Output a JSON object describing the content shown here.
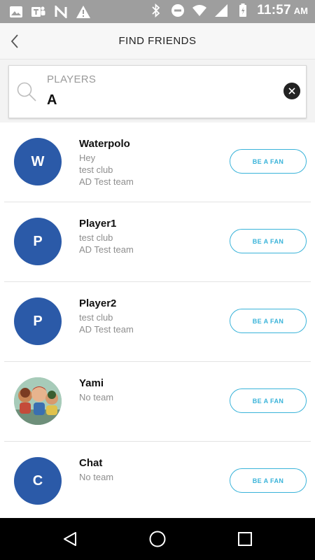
{
  "status_bar": {
    "time": "11:57",
    "ampm": "AM",
    "left_icons": [
      "image-icon",
      "teams-icon",
      "n-app-icon",
      "warning-icon"
    ],
    "right_icons": [
      "bluetooth-icon",
      "do-not-disturb-icon",
      "wifi-icon",
      "signal-icon",
      "battery-icon"
    ]
  },
  "header": {
    "title": "FIND FRIENDS"
  },
  "search": {
    "label": "PLAYERS",
    "value": "A"
  },
  "players": [
    {
      "initial": "W",
      "name": "Waterpolo",
      "lines": [
        "Hey",
        "test club",
        "AD Test team"
      ],
      "button": "BE A FAN",
      "photo": false
    },
    {
      "initial": "P",
      "name": "Player1",
      "lines": [
        "test club",
        "AD Test team"
      ],
      "button": "BE A FAN",
      "photo": false
    },
    {
      "initial": "P",
      "name": "Player2",
      "lines": [
        "test club",
        "AD Test team"
      ],
      "button": "BE A FAN",
      "photo": false
    },
    {
      "initial": "",
      "name": "Yami",
      "lines": [
        "No team"
      ],
      "button": "BE A FAN",
      "photo": true
    },
    {
      "initial": "C",
      "name": "Chat",
      "lines": [
        "No team"
      ],
      "button": "BE A FAN",
      "photo": false
    }
  ],
  "colors": {
    "status_bar": "#9e9e9e",
    "avatar": "#2b5aa8",
    "accent": "#39b3d9",
    "nav_bar": "#000000"
  }
}
